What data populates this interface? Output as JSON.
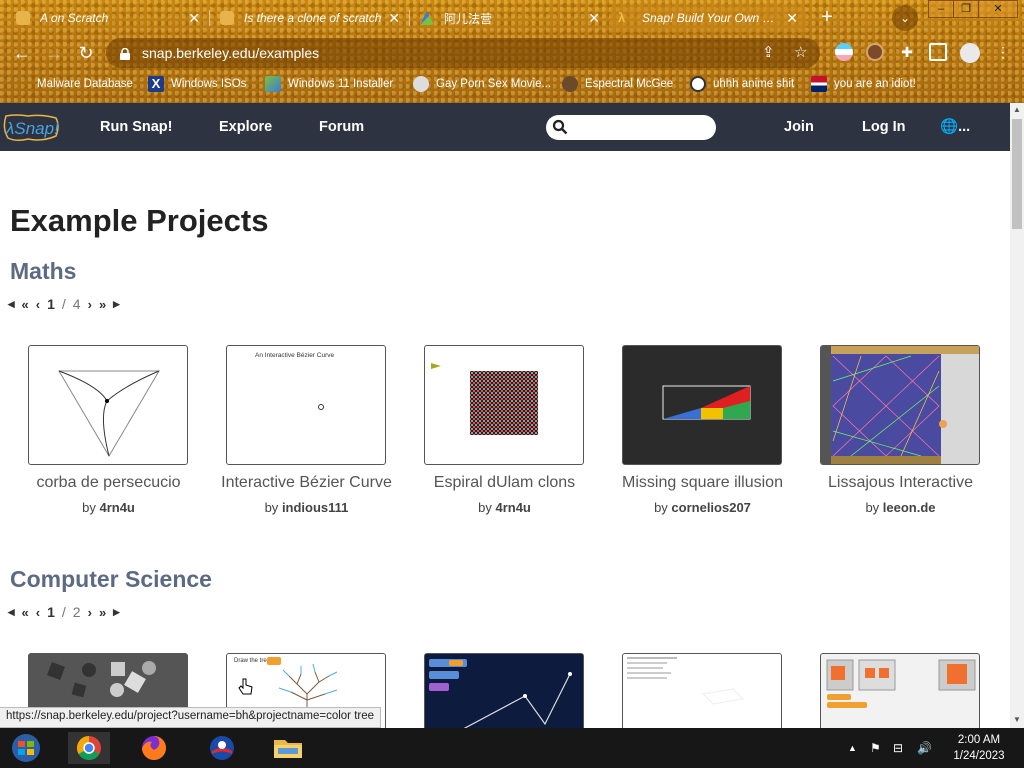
{
  "browser": {
    "tabs": [
      {
        "title": "A on Scratch",
        "favicon_color": "#e7b34a"
      },
      {
        "title": "Is there a clone of scratch",
        "favicon_color": "#e7b34a"
      },
      {
        "title": "阿儿法营",
        "favicon_color": "#3a7bd5"
      },
      {
        "title": "Snap! Build Your Own Blocks",
        "favicon_color": "#d7a631"
      }
    ],
    "url": "snap.berkeley.edu/examples",
    "bookmarks": [
      {
        "label": "Malware Database"
      },
      {
        "label": "Windows ISOs"
      },
      {
        "label": "Windows 11 Installer"
      },
      {
        "label": "Gay Porn Sex Movie..."
      },
      {
        "label": "Espectral McGee"
      },
      {
        "label": "uhhh anime shit"
      },
      {
        "label": "you are an idiot!"
      }
    ]
  },
  "site": {
    "nav": {
      "run": "Run Snap!",
      "explore": "Explore",
      "forum": "Forum",
      "join": "Join",
      "login": "Log In",
      "language": "..."
    },
    "search_placeholder": ""
  },
  "page": {
    "title": "Example Projects",
    "sections": [
      {
        "title": "Maths",
        "page": "1",
        "total": "4",
        "projects": [
          {
            "title": "corba de persecucio",
            "by": "by",
            "author": "4rn4u"
          },
          {
            "title": "Interactive Bézier Curve",
            "by": "by",
            "author": "indious111",
            "thumb_text": "An Interactive Bézier Curve"
          },
          {
            "title": "Espiral dUlam clons",
            "by": "by",
            "author": "4rn4u"
          },
          {
            "title": "Missing square illusion",
            "by": "by",
            "author": "cornelios207"
          },
          {
            "title": "Lissajous Interactive",
            "by": "by",
            "author": "leeon.de"
          }
        ]
      },
      {
        "title": "Computer Science",
        "page": "1",
        "total": "2",
        "projects": [
          {
            "thumb_text": "Draw the tree"
          },
          {},
          {},
          {},
          {}
        ]
      }
    ]
  },
  "status_url": "https://snap.berkeley.edu/project?username=bh&projectname=color tree",
  "taskbar": {
    "time": "2:00 AM",
    "date": "1/24/2023"
  },
  "colors": {
    "nav_bg": "#2d3341",
    "section_title": "#5c6a83",
    "chrome_accent": "#b87710"
  }
}
